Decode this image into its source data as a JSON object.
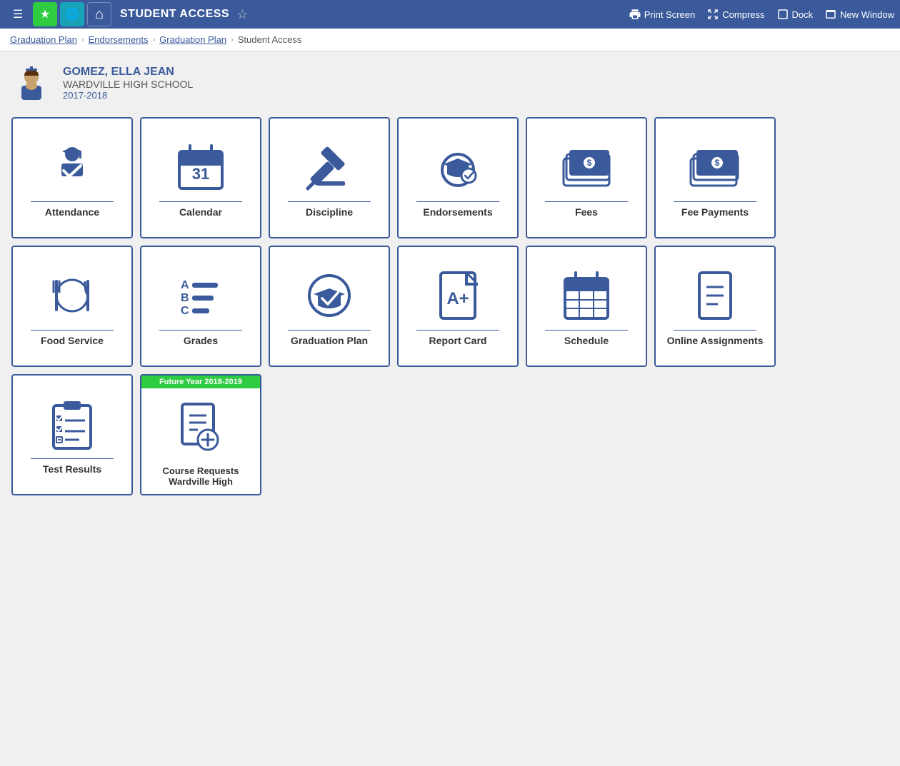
{
  "topbar": {
    "title": "STUDENT ACCESS",
    "actions": {
      "print": "Print Screen",
      "compress": "Compress",
      "dock": "Dock",
      "newWindow": "New Window"
    }
  },
  "breadcrumb": {
    "items": [
      "Graduation Plan",
      "Endorsements",
      "Graduation Plan",
      "Student Access"
    ]
  },
  "student": {
    "name": "GOMEZ, ELLA JEAN",
    "school": "WARDVILLE HIGH SCHOOL",
    "year": "2017-2018"
  },
  "tiles": [
    [
      {
        "id": "attendance",
        "label": "Attendance",
        "icon": "graduation-check"
      },
      {
        "id": "calendar",
        "label": "Calendar",
        "icon": "calendar"
      },
      {
        "id": "discipline",
        "label": "Discipline",
        "icon": "gavel"
      },
      {
        "id": "endorsements",
        "label": "Endorsements",
        "icon": "endorsements"
      },
      {
        "id": "fees",
        "label": "Fees",
        "icon": "money"
      },
      {
        "id": "fee-payments",
        "label": "Fee Payments",
        "icon": "money-stack"
      }
    ],
    [
      {
        "id": "food-service",
        "label": "Food Service",
        "icon": "food"
      },
      {
        "id": "grades",
        "label": "Grades",
        "icon": "grades"
      },
      {
        "id": "graduation-plan",
        "label": "Graduation Plan",
        "icon": "grad-check"
      },
      {
        "id": "report-card",
        "label": "Report Card",
        "icon": "report-card"
      },
      {
        "id": "schedule",
        "label": "Schedule",
        "icon": "schedule"
      },
      {
        "id": "online-assignments",
        "label": "Online Assignments",
        "icon": "document"
      }
    ],
    [
      {
        "id": "test-results",
        "label": "Test Results",
        "icon": "checklist"
      },
      {
        "id": "course-requests",
        "label": "Course Requests\nWardville High",
        "icon": "course-requests",
        "badge": "Future Year 2018-2019"
      }
    ]
  ],
  "colors": {
    "brand": "#3a5a9b",
    "green": "#2ecc40"
  }
}
